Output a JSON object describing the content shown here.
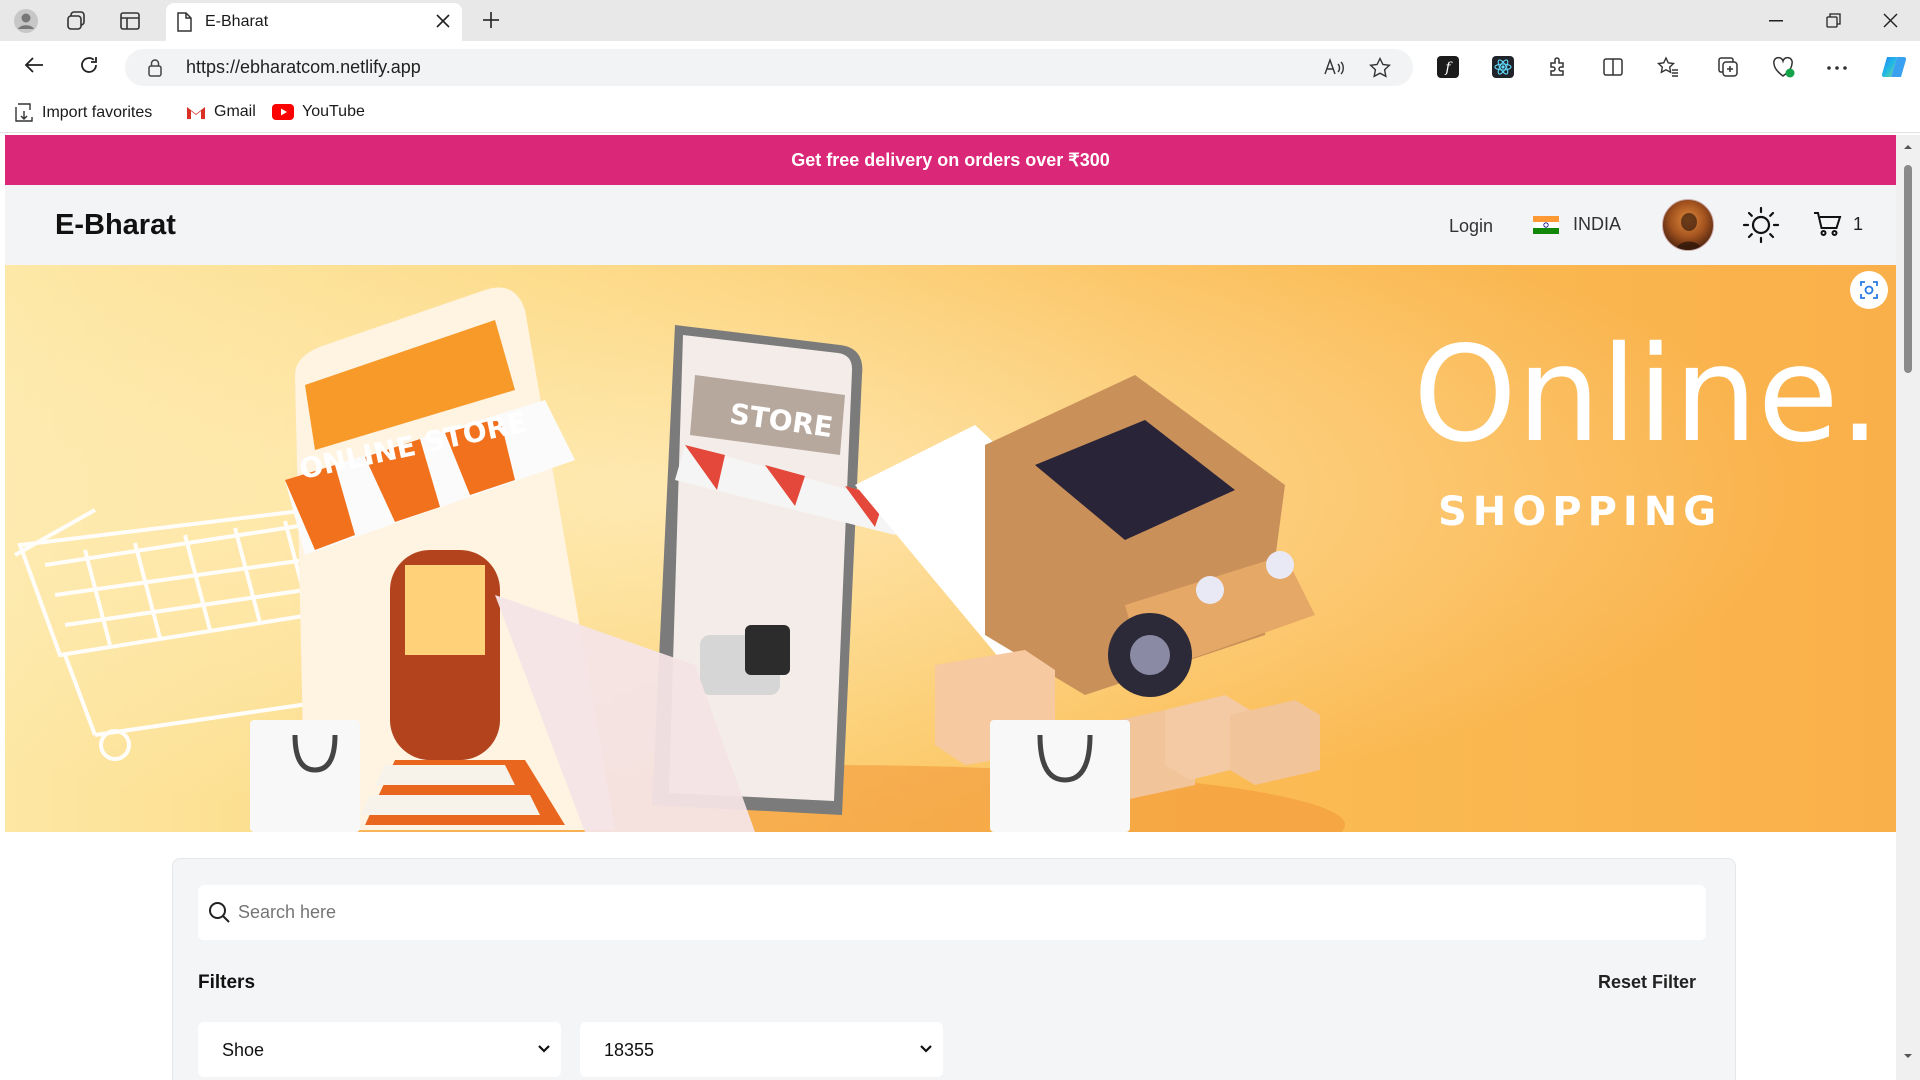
{
  "browser": {
    "tab_title": "E-Bharat",
    "url": "https://ebharatcom.netlify.app",
    "favorites": [
      {
        "label": "Import favorites",
        "icon": "import-favorites-icon"
      },
      {
        "label": "Gmail",
        "icon": "gmail-icon"
      },
      {
        "label": "YouTube",
        "icon": "youtube-icon"
      }
    ]
  },
  "promo": {
    "text": "Get free delivery on orders over ₹300"
  },
  "navbar": {
    "brand": "E-Bharat",
    "login": "Login",
    "country": "INDIA",
    "cart_count": "1"
  },
  "hero": {
    "store_sign": "ONLINE STORE",
    "phone_sign": "STORE",
    "headline": "Online.",
    "subheadline": "SHOPPING"
  },
  "filters": {
    "search_placeholder": "Search here",
    "title": "Filters",
    "reset_label": "Reset Filter",
    "category_value": "Shoe",
    "price_value": "18355"
  },
  "colors": {
    "promo_bg": "#db2777",
    "navbar_bg": "#f3f4f6",
    "hero_orange": "#fab04a"
  }
}
